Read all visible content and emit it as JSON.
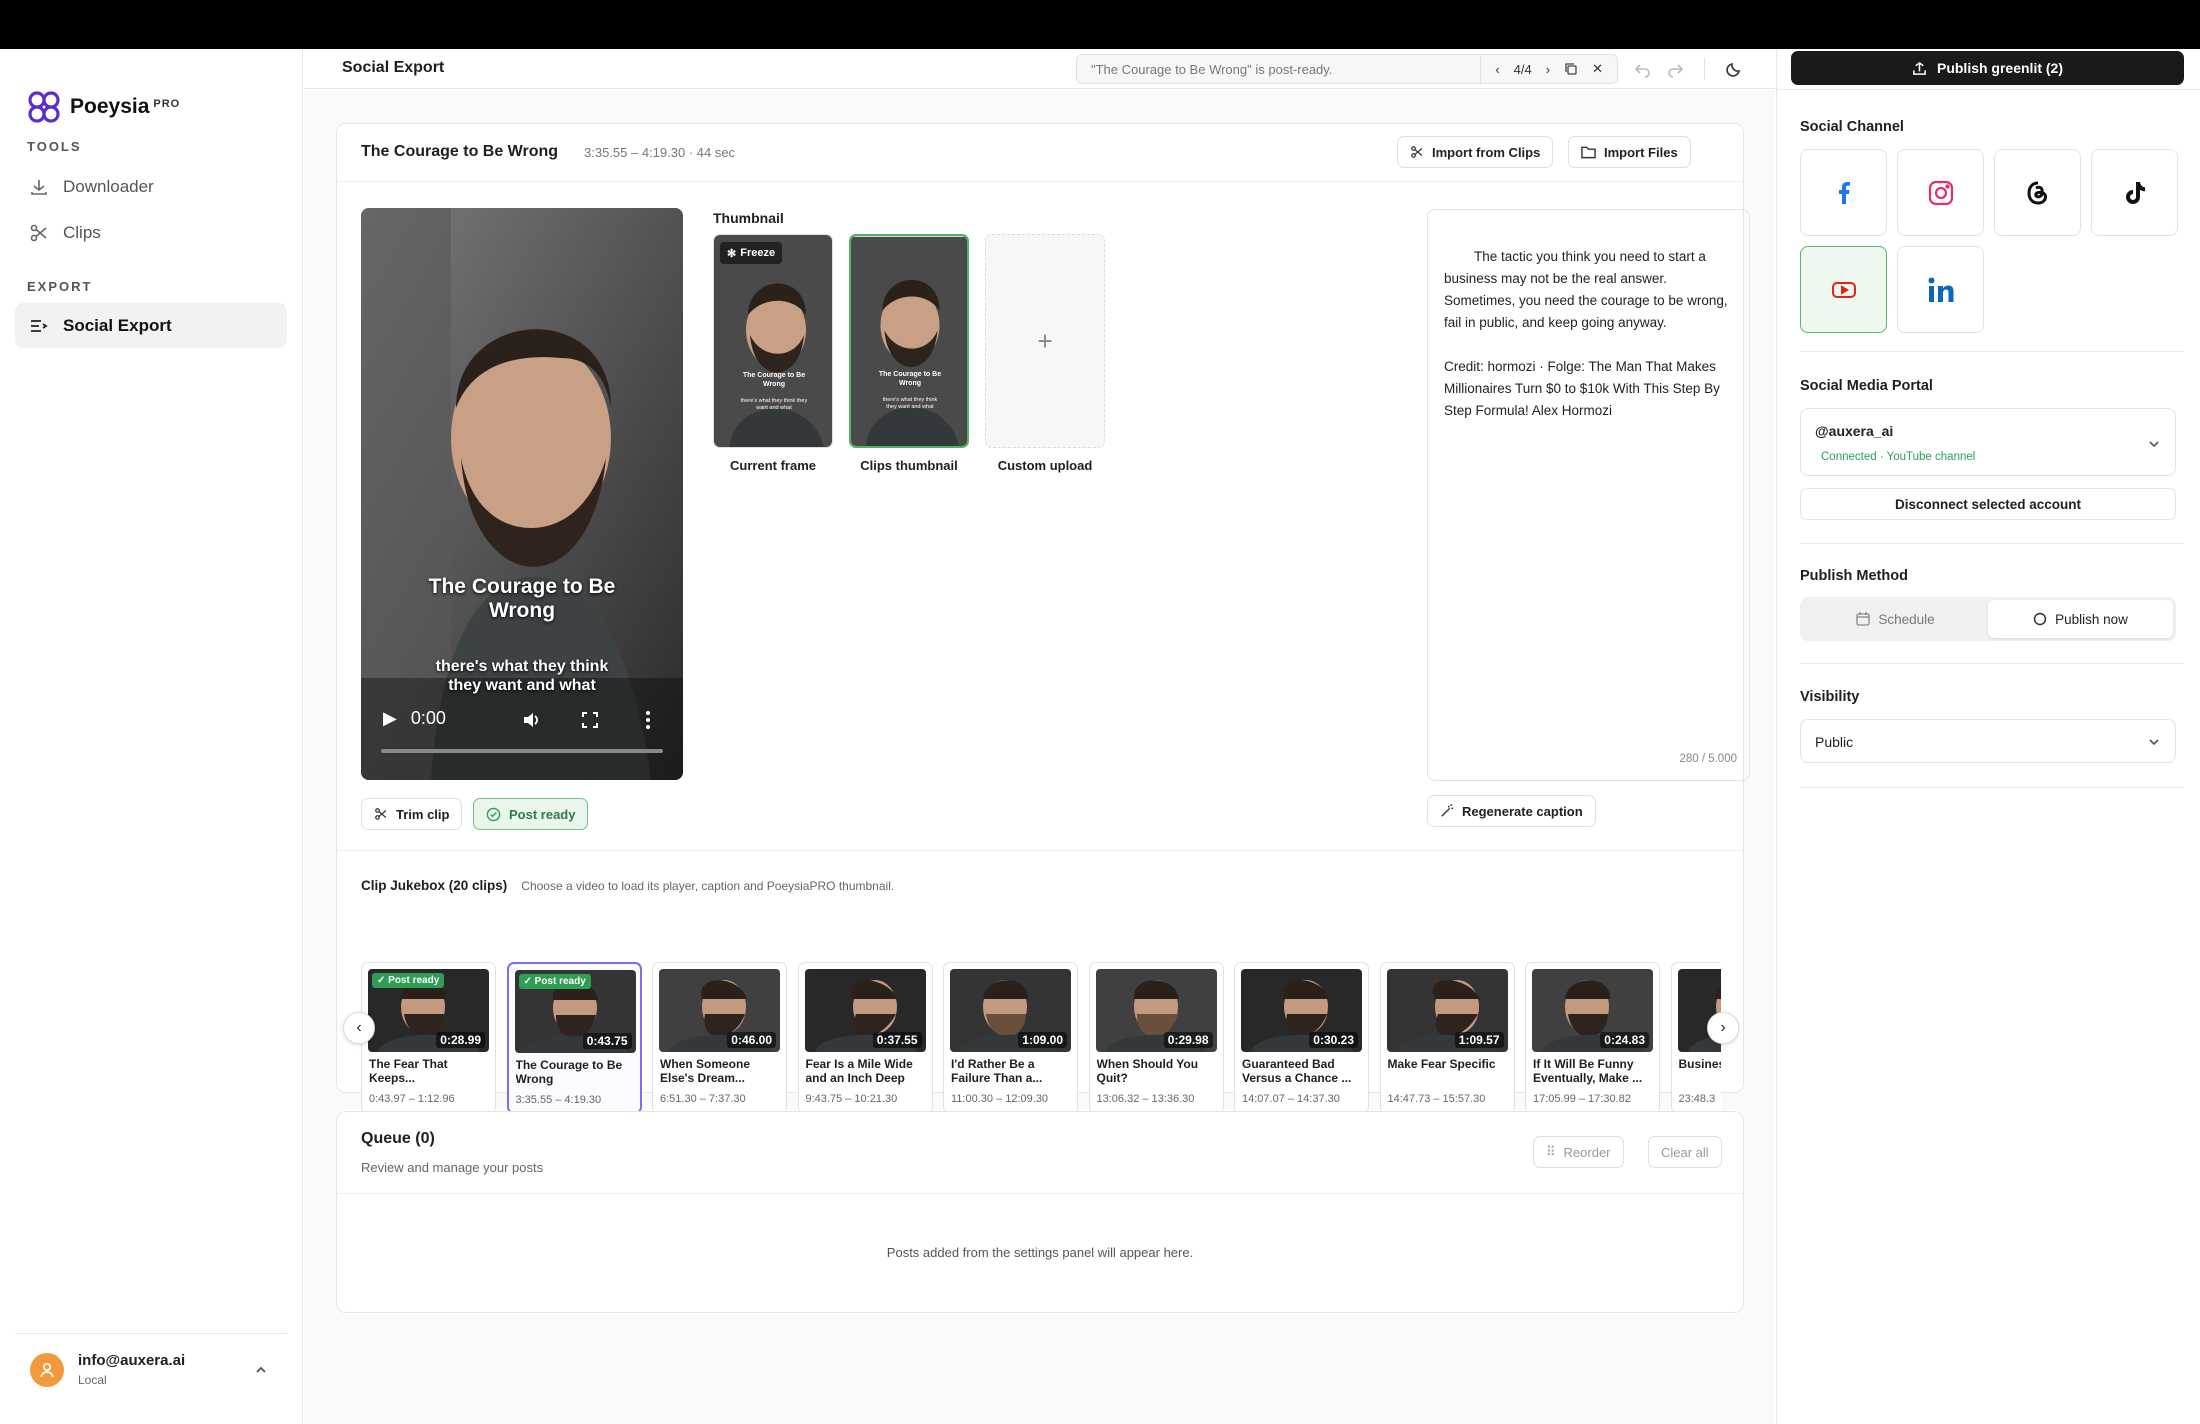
{
  "app": {
    "name": "Poeysia",
    "badge": "PRO"
  },
  "sidebar": {
    "tools_label": "TOOLS",
    "export_label": "EXPORT",
    "items": [
      {
        "label": "Downloader",
        "icon": "download-icon"
      },
      {
        "label": "Clips",
        "icon": "scissors-icon"
      },
      {
        "label": "Social Export",
        "icon": "list-export-icon"
      }
    ],
    "user": {
      "email": "info@auxera.ai",
      "mode": "Local"
    }
  },
  "header": {
    "title": "Social Export",
    "notice": "\"The Courage to Be Wrong\" is post-ready.",
    "pager": "4/4"
  },
  "clip_editor": {
    "title": "The Courage to Be Wrong",
    "meta": "3:35.55 – 4:19.30 · 44 sec",
    "import_clips": "Import from Clips",
    "import_files": "Import Files",
    "video": {
      "overlay_title": "The Courage to Be Wrong",
      "overlay_sub": "there's what they think they want and what",
      "time": "0:00"
    },
    "thumbnail_label": "Thumbnail",
    "freeze": "Freeze",
    "thumbs": [
      {
        "label": "Current frame"
      },
      {
        "label": "Clips thumbnail"
      },
      {
        "label": "Custom upload"
      }
    ],
    "thumb_overlay_title": "The Courage to Be Wrong",
    "thumb_overlay_sub": "there's what they think they want and what",
    "trim": "Trim clip",
    "post_ready": "Post ready",
    "caption": "The tactic you think you need to start a business may not be the real answer. Sometimes, you need the courage to be wrong, fail in public, and keep going anyway.\n\nCredit: hormozi · Folge: The Man That Makes Millionaires Turn $0 to $10k With This Step By Step Formula! Alex Hormozi",
    "char_count": "280 / 5.000",
    "regenerate": "Regenerate caption"
  },
  "jukebox": {
    "title": "Clip Jukebox (20 clips)",
    "hint": "Choose a video to load its player, caption and PoeysiaPRO thumbnail.",
    "post_ready_badge": "✓ Post ready",
    "clips": [
      {
        "title": "The Fear That Keeps...",
        "range": "0:43.97 – 1:12.96",
        "duration": "0:28.99",
        "ready": true
      },
      {
        "title": "The Courage to Be Wrong",
        "range": "3:35.55 – 4:19.30",
        "duration": "0:43.75",
        "ready": true
      },
      {
        "title": "When Someone Else's Dream...",
        "range": "6:51.30 – 7:37.30",
        "duration": "0:46.00",
        "ready": false
      },
      {
        "title": "Fear Is a Mile Wide and an Inch Deep",
        "range": "9:43.75 – 10:21.30",
        "duration": "0:37.55",
        "ready": false
      },
      {
        "title": "I'd Rather Be a Failure Than a...",
        "range": "11:00.30 – 12:09.30",
        "duration": "1:09.00",
        "ready": false
      },
      {
        "title": "When Should You Quit?",
        "range": "13:06.32 – 13:36.30",
        "duration": "0:29.98",
        "ready": false
      },
      {
        "title": "Guaranteed Bad Versus a Chance ...",
        "range": "14:07.07 – 14:37.30",
        "duration": "0:30.23",
        "ready": false
      },
      {
        "title": "Make Fear Specific",
        "range": "14:47.73 – 15:57.30",
        "duration": "1:09.57",
        "ready": false
      },
      {
        "title": "If It Will Be Funny Eventually, Make ...",
        "range": "17:05.99 – 17:30.82",
        "duration": "0:24.83",
        "ready": false
      },
      {
        "title": "Business Come I...",
        "range": "23:48.3",
        "duration": "",
        "ready": false
      }
    ]
  },
  "queue": {
    "title": "Queue (0)",
    "subtitle": "Review and manage your posts",
    "reorder": "Reorder",
    "clear": "Clear all",
    "empty": "Posts added from the settings panel will appear here."
  },
  "right": {
    "publish": "Publish greenlit (2)",
    "social_channel": "Social Channel",
    "channels": [
      "facebook",
      "instagram",
      "threads",
      "tiktok",
      "youtube",
      "linkedin"
    ],
    "selected_channel": "youtube",
    "portal_label": "Social Media Portal",
    "account": "@auxera_ai",
    "account_status": "Connected · YouTube channel",
    "disconnect": "Disconnect selected account",
    "method_label": "Publish Method",
    "schedule": "Schedule",
    "publish_now": "Publish now",
    "visibility_label": "Visibility",
    "visibility": "Public"
  },
  "colors": {
    "accent": "#7b6ef0",
    "ready": "#2e9e55",
    "youtube": "#e62117",
    "linkedin": "#0a66c2",
    "facebook": "#1877f2"
  }
}
